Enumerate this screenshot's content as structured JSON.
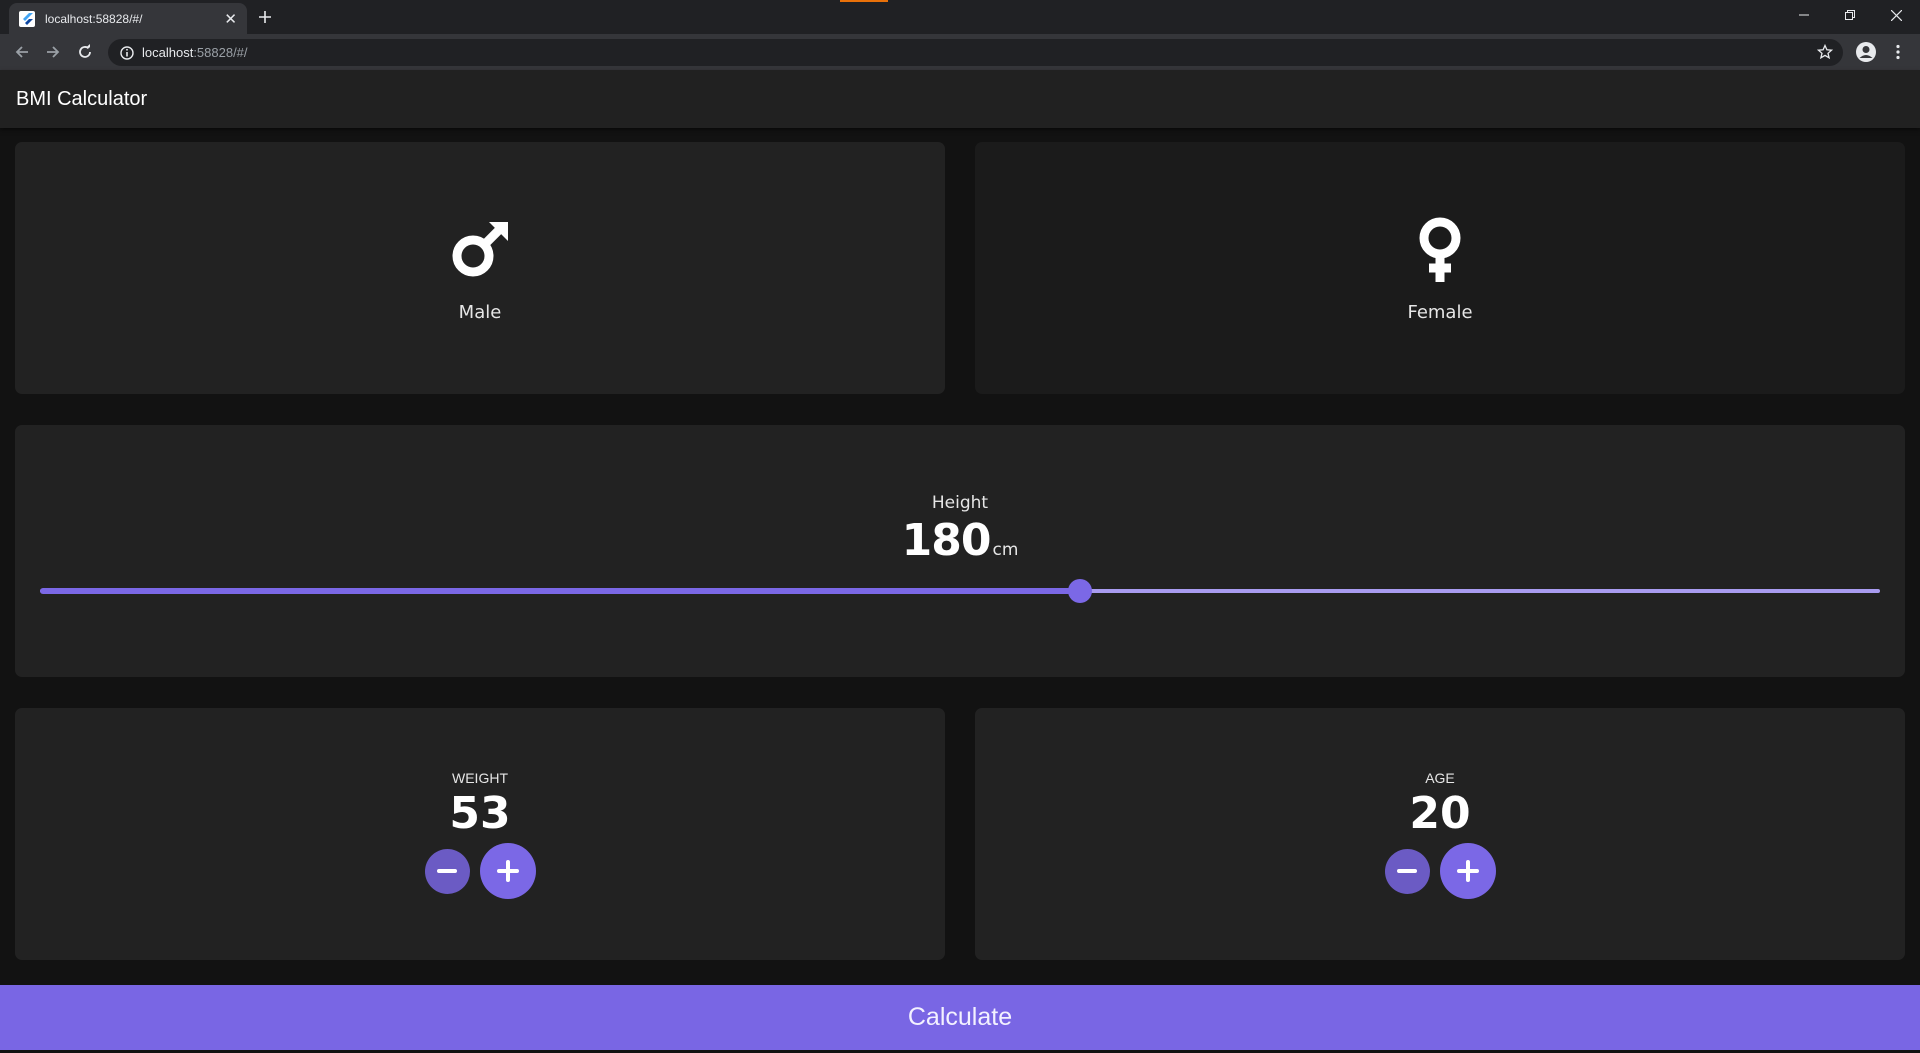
{
  "browser": {
    "tab_title": "localhost:58828/#/",
    "url_host": "localhost",
    "url_rest": ":58828/#/",
    "new_tab_icon": "plus-icon",
    "tab_close_glyph": "✕"
  },
  "app": {
    "title": "BMI Calculator"
  },
  "gender": {
    "male_label": "Male",
    "female_label": "Female",
    "selected": "male"
  },
  "height": {
    "label": "Height",
    "value": "180",
    "unit": "cm",
    "slider_fraction": 0.565
  },
  "weight": {
    "label": "WEIGHT",
    "value": "53"
  },
  "age": {
    "label": "AGE",
    "value": "20"
  },
  "calculate_label": "Calculate",
  "colors": {
    "accent": "#7966e4",
    "card": "#222222",
    "card_inactive": "#1b1b1b",
    "background": "#121212"
  }
}
